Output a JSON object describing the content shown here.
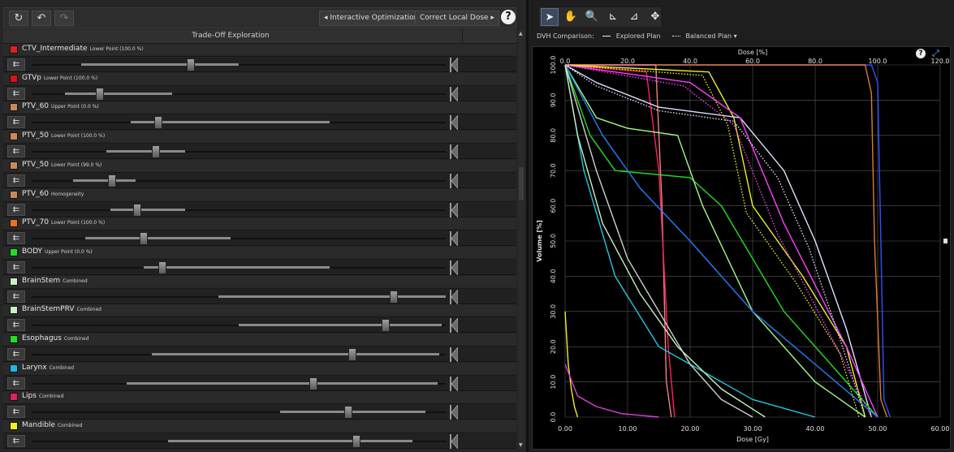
{
  "toolbar": {
    "refresh_icon": "↻",
    "undo_icon": "↶",
    "redo_icon": "↷",
    "interactive_optimization_label": "Interactive Optimization",
    "correct_local_dose_label": "Correct Local Dose",
    "help_label": "?"
  },
  "tradeoff": {
    "title": "Trade-Off Exploration",
    "lock_icon": "⇇",
    "items": [
      {
        "name": "CTV_Intermediate",
        "sub": "Lower Point (100.0 %)",
        "color": "#e02020",
        "value": 0.385,
        "range": [
          0.12,
          0.5
        ]
      },
      {
        "name": "GTVp",
        "sub": "Lower Point (100.0 %)",
        "color": "#e01010",
        "value": 0.165,
        "range": [
          0.08,
          0.34
        ]
      },
      {
        "name": "PTV_60",
        "sub": "Upper Point (0.0 %)",
        "color": "#c98a5a",
        "value": 0.305,
        "range": [
          0.24,
          0.72
        ]
      },
      {
        "name": "PTV_50",
        "sub": "Lower Point (100.0 %)",
        "color": "#c98a5a",
        "value": 0.3,
        "range": [
          0.18,
          0.37
        ]
      },
      {
        "name": "PTV_50",
        "sub": "Lower Point (99.0 %)",
        "color": "#c98a5a",
        "value": 0.195,
        "range": [
          0.1,
          0.25
        ]
      },
      {
        "name": "PTV_60",
        "sub": "Homogeneity",
        "color": "#c98a5a",
        "value": 0.255,
        "range": [
          0.19,
          0.37
        ]
      },
      {
        "name": "PTV_70",
        "sub": "Lower Point (100.0 %)",
        "color": "#f07020",
        "value": 0.27,
        "range": [
          0.13,
          0.48
        ]
      },
      {
        "name": "BODY",
        "sub": "Upper Point (0.0 %)",
        "color": "#20e020",
        "value": 0.315,
        "range": [
          0.27,
          0.72
        ]
      },
      {
        "name": "BrainStem",
        "sub": "Combined",
        "color": "#c8f0c0",
        "value": 0.875,
        "range": [
          0.45,
          1.0
        ]
      },
      {
        "name": "BrainStemPRV",
        "sub": "Combined",
        "color": "#c8f0c0",
        "value": 0.855,
        "range": [
          0.5,
          0.99
        ]
      },
      {
        "name": "Esophagus",
        "sub": "Combined",
        "color": "#20e020",
        "value": 0.775,
        "range": [
          0.29,
          0.985
        ]
      },
      {
        "name": "Larynx",
        "sub": "Combined",
        "color": "#20b8e8",
        "value": 0.68,
        "range": [
          0.23,
          0.98
        ]
      },
      {
        "name": "Lips",
        "sub": "Combined",
        "color": "#e02060",
        "value": 0.765,
        "range": [
          0.6,
          0.95
        ]
      },
      {
        "name": "Mandible",
        "sub": "Combined",
        "color": "#f0f020",
        "value": 0.785,
        "range": [
          0.33,
          0.92
        ]
      }
    ]
  },
  "right_toolbar": {
    "tools": [
      {
        "name": "pointer",
        "glyph": "➤"
      },
      {
        "name": "pan",
        "glyph": "✋"
      },
      {
        "name": "zoom",
        "glyph": "🔍"
      },
      {
        "name": "measure",
        "glyph": "⊾"
      },
      {
        "name": "measure2",
        "glyph": "⊿"
      },
      {
        "name": "fit",
        "glyph": "✥"
      }
    ]
  },
  "dvh": {
    "comparison_label": "DVH Comparison:",
    "explored_label": "Explored Plan",
    "balanced_label": "Balanced Plan ▾",
    "help_label": "?"
  },
  "chart_data": {
    "type": "line",
    "title": "",
    "xlabel": "Dose [Gy]",
    "x2label": "Dose [%]",
    "ylabel": "Volume [%]",
    "xlim": [
      0,
      60
    ],
    "x2lim": [
      0,
      120
    ],
    "ylim": [
      0,
      100
    ],
    "x_ticks": [
      "0.00",
      "10.00",
      "20.00",
      "30.00",
      "40.00",
      "50.00",
      "60.00"
    ],
    "x2_ticks": [
      "0.0",
      "20.0",
      "40.0",
      "60.0",
      "80.0",
      "100.0",
      "120.0"
    ],
    "y_ticks": [
      "0.0",
      "10.0",
      "20.0",
      "30.0",
      "40.0",
      "50.0",
      "60.0",
      "70.0",
      "80.0",
      "90.0",
      "100.0"
    ],
    "grid": true,
    "series": [
      {
        "color": "#3050ff",
        "dash": false,
        "x": [
          0,
          49,
          50,
          50.5,
          51,
          52
        ],
        "y": [
          100,
          100,
          95,
          50,
          5,
          0
        ]
      },
      {
        "color": "#e07a30",
        "dash": false,
        "x": [
          0,
          48,
          49,
          49.5,
          50.5,
          51.5
        ],
        "y": [
          100,
          100,
          92,
          50,
          5,
          0
        ]
      },
      {
        "color": "#f08080",
        "dash": false,
        "x": [
          0,
          14.5,
          15.5,
          16.2,
          17
        ],
        "y": [
          100,
          100,
          60,
          10,
          0
        ]
      },
      {
        "color": "#ff2060",
        "dash": false,
        "x": [
          0,
          13,
          15,
          16.5,
          17.5
        ],
        "y": [
          100,
          98,
          70,
          20,
          0
        ]
      },
      {
        "color": "#f0f020",
        "dash": false,
        "x": [
          0,
          23,
          27,
          30,
          38,
          45,
          48
        ],
        "y": [
          100,
          98,
          85,
          60,
          40,
          20,
          0
        ]
      },
      {
        "color": "#f0f020",
        "dash": false,
        "x": [
          0,
          0.5,
          1,
          1.5,
          2
        ],
        "y": [
          30,
          15,
          8,
          3,
          0
        ]
      },
      {
        "color": "#e0e0ff",
        "dash": false,
        "x": [
          0,
          5,
          15,
          28,
          35,
          40,
          45,
          49
        ],
        "y": [
          100,
          95,
          88,
          85,
          70,
          50,
          25,
          0
        ]
      },
      {
        "color": "#ff40ff",
        "dash": false,
        "x": [
          0,
          20,
          28,
          35,
          45,
          50
        ],
        "y": [
          100,
          95,
          85,
          55,
          20,
          0
        ]
      },
      {
        "color": "#e040e0",
        "dash": false,
        "x": [
          0,
          2,
          5,
          9,
          12,
          15
        ],
        "y": [
          15,
          6,
          3,
          1,
          0.5,
          0
        ]
      },
      {
        "color": "#20e020",
        "dash": false,
        "x": [
          0,
          4,
          8,
          20,
          25,
          35,
          45,
          50
        ],
        "y": [
          100,
          80,
          70,
          68,
          60,
          30,
          10,
          0
        ]
      },
      {
        "color": "#a0ff80",
        "dash": false,
        "x": [
          0,
          5,
          10,
          18,
          22,
          30,
          40,
          48
        ],
        "y": [
          100,
          85,
          82,
          80,
          60,
          30,
          10,
          0
        ]
      },
      {
        "color": "#20c8e0",
        "dash": false,
        "x": [
          0,
          3,
          8,
          15,
          20,
          30,
          40
        ],
        "y": [
          100,
          70,
          40,
          20,
          15,
          5,
          0
        ]
      },
      {
        "color": "#2080ff",
        "dash": false,
        "x": [
          0,
          6,
          12,
          20,
          30,
          40,
          50
        ],
        "y": [
          100,
          80,
          65,
          50,
          30,
          15,
          0
        ]
      },
      {
        "color": "#d0d0d0",
        "dash": false,
        "x": [
          0,
          5,
          10,
          15,
          20,
          25,
          30
        ],
        "y": [
          100,
          70,
          45,
          30,
          15,
          5,
          0
        ]
      },
      {
        "color": "#c8f0c0",
        "dash": false,
        "x": [
          0,
          2,
          6,
          12,
          18,
          25,
          32
        ],
        "y": [
          100,
          80,
          55,
          35,
          20,
          8,
          0
        ]
      },
      {
        "color": "#e0e0ff",
        "dash": true,
        "x": [
          0,
          5,
          15,
          27,
          34,
          39,
          44,
          48
        ],
        "y": [
          100,
          94,
          87,
          84,
          68,
          48,
          22,
          0
        ]
      },
      {
        "color": "#ff40ff",
        "dash": true,
        "x": [
          0,
          19,
          27,
          34,
          44,
          49
        ],
        "y": [
          100,
          94,
          83,
          52,
          18,
          0
        ]
      },
      {
        "color": "#f0f020",
        "dash": true,
        "x": [
          0,
          22,
          26,
          29,
          37,
          44,
          47
        ],
        "y": [
          100,
          97,
          83,
          58,
          38,
          18,
          0
        ]
      }
    ]
  }
}
